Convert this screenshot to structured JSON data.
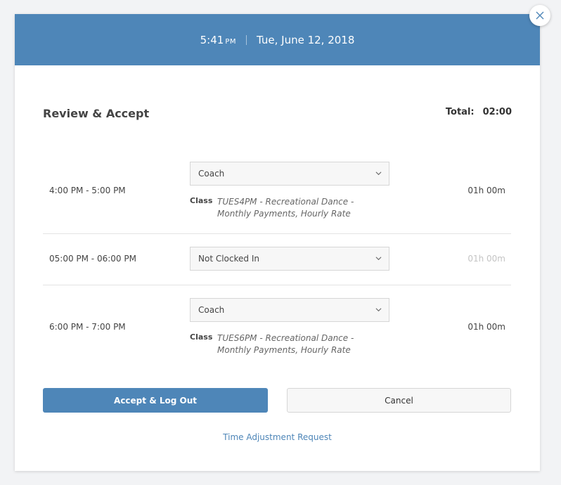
{
  "header": {
    "time": "5:41",
    "ampm": "PM",
    "date": "Tue, June 12, 2018"
  },
  "close_icon": "×",
  "title": "Review & Accept",
  "total": {
    "label": "Total:",
    "value": "02:00"
  },
  "rows": [
    {
      "time_range": "4:00 PM - 5:00 PM",
      "role": "Coach",
      "class_label": "Class",
      "class_desc": "TUES4PM - Recreational Dance - Monthly Payments, Hourly Rate",
      "duration": "01h 00m"
    },
    {
      "time_range": "05:00 PM - 06:00 PM",
      "role": "Not Clocked In",
      "duration": "01h 00m"
    },
    {
      "time_range": "6:00 PM - 7:00 PM",
      "role": "Coach",
      "class_label": "Class",
      "class_desc": "TUES6PM - Recreational Dance - Monthly Payments, Hourly Rate",
      "duration": "01h 00m"
    }
  ],
  "buttons": {
    "accept": "Accept & Log Out",
    "cancel": "Cancel"
  },
  "link": "Time Adjustment Request",
  "colors": {
    "accent": "#4e86b8",
    "muted_text": "#c4c4c4"
  }
}
